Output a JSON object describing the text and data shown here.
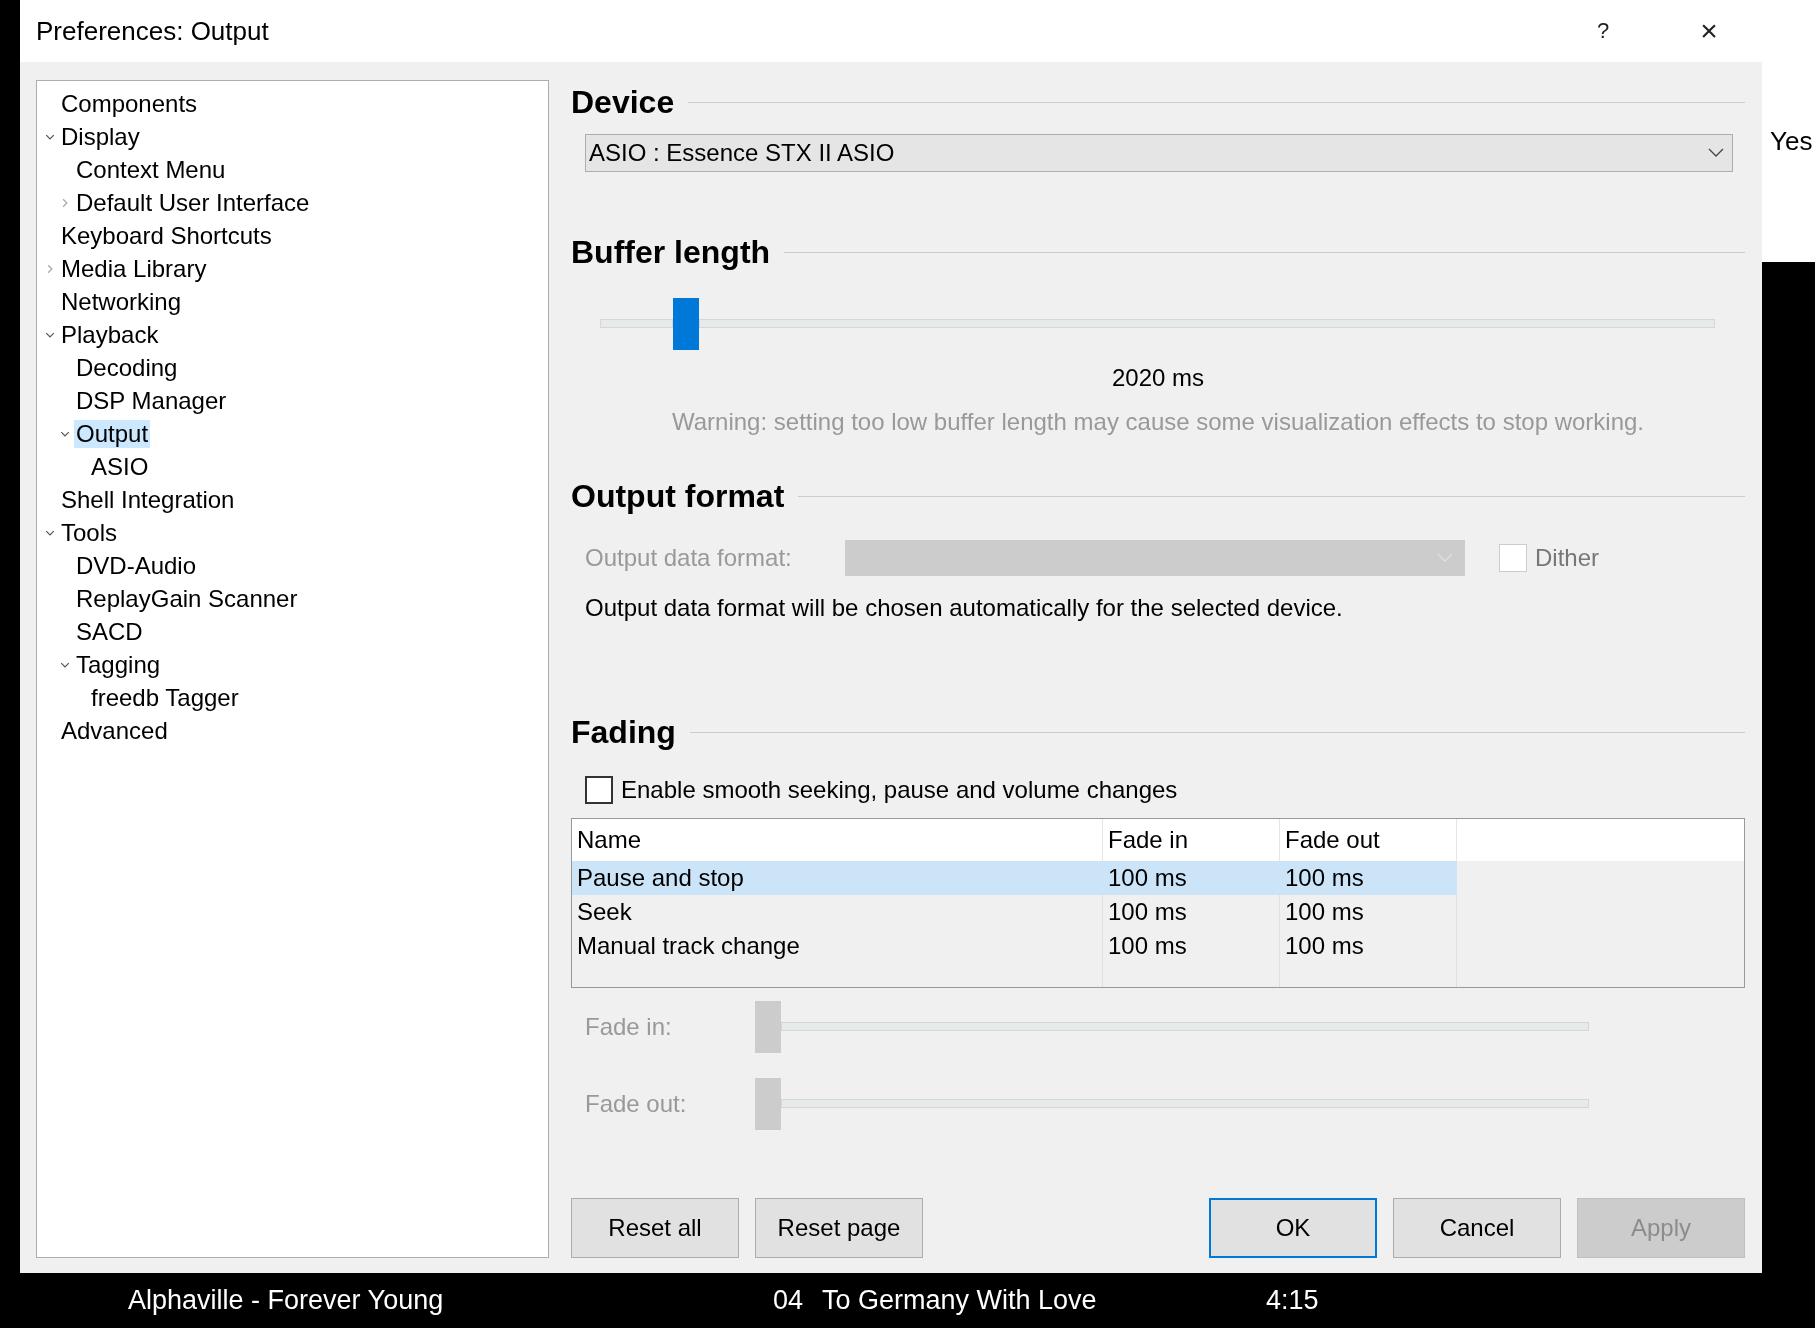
{
  "window": {
    "title": "Preferences: Output",
    "help": "?",
    "close": "×"
  },
  "tree": [
    {
      "label": "Components",
      "selected": false
    },
    {
      "label": "Display",
      "selected": false,
      "expanded": true,
      "children": [
        {
          "label": "Context Menu",
          "selected": false
        },
        {
          "label": "Default User Interface",
          "selected": false,
          "expanded": false
        }
      ]
    },
    {
      "label": "Keyboard Shortcuts",
      "selected": false
    },
    {
      "label": "Media Library",
      "selected": false,
      "expanded": false
    },
    {
      "label": "Networking",
      "selected": false
    },
    {
      "label": "Playback",
      "selected": false,
      "expanded": true,
      "children": [
        {
          "label": "Decoding",
          "selected": false
        },
        {
          "label": "DSP Manager",
          "selected": false
        },
        {
          "label": "Output",
          "selected": true,
          "expanded": true,
          "children": [
            {
              "label": "ASIO",
              "selected": false
            }
          ]
        }
      ]
    },
    {
      "label": "Shell Integration",
      "selected": false
    },
    {
      "label": "Tools",
      "selected": false,
      "expanded": true,
      "children": [
        {
          "label": "DVD-Audio",
          "selected": false
        },
        {
          "label": "ReplayGain Scanner",
          "selected": false
        },
        {
          "label": "SACD",
          "selected": false
        },
        {
          "label": "Tagging",
          "selected": false,
          "expanded": true,
          "children": [
            {
              "label": "freedb Tagger",
              "selected": false
            }
          ]
        }
      ]
    },
    {
      "label": "Advanced",
      "selected": false
    }
  ],
  "device": {
    "heading": "Device",
    "value": "ASIO : Essence STX II ASIO"
  },
  "buffer": {
    "heading": "Buffer length",
    "level": 0.077,
    "reading": "2020 ms",
    "warning": "Warning: setting too low buffer length may cause some visualization effects to stop working."
  },
  "output_format": {
    "heading": "Output format",
    "label": "Output data format:",
    "disabled": true,
    "dither": {
      "label": "Dither",
      "checked": false
    },
    "note": "Output data format will be chosen automatically for the selected device."
  },
  "fading": {
    "heading": "Fading",
    "smooth": {
      "label": "Enable smooth seeking, pause and volume changes",
      "checked": false
    },
    "table": {
      "columns": [
        "Name",
        "Fade in",
        "Fade out"
      ],
      "rows": [
        {
          "cells": [
            "Pause and stop",
            "100 ms",
            "100 ms"
          ],
          "selected": true
        },
        {
          "cells": [
            "Seek",
            "100 ms",
            "100 ms"
          ],
          "selected": false
        },
        {
          "cells": [
            "Manual track change",
            "100 ms",
            "100 ms"
          ],
          "selected": false
        }
      ]
    },
    "sliders": [
      {
        "label": "Fade in:",
        "level": 0,
        "disabled": true
      },
      {
        "label": "Fade out:",
        "level": 0,
        "disabled": true
      }
    ]
  },
  "buttons": [
    {
      "label": "Reset all",
      "kind": "left",
      "default": false,
      "disabled": false
    },
    {
      "label": "Reset page",
      "kind": "left",
      "default": false,
      "disabled": false
    },
    {
      "label": "OK",
      "kind": "right",
      "default": true,
      "disabled": false
    },
    {
      "label": "Cancel",
      "kind": "right",
      "default": false,
      "disabled": false
    },
    {
      "label": "Apply",
      "kind": "right",
      "default": false,
      "disabled": true
    }
  ],
  "background": {
    "side_text": "Yes",
    "now_playing": {
      "artist_title": "Alphaville - Forever Young",
      "track": "04",
      "title": "To Germany With Love",
      "time": "4:15"
    }
  }
}
